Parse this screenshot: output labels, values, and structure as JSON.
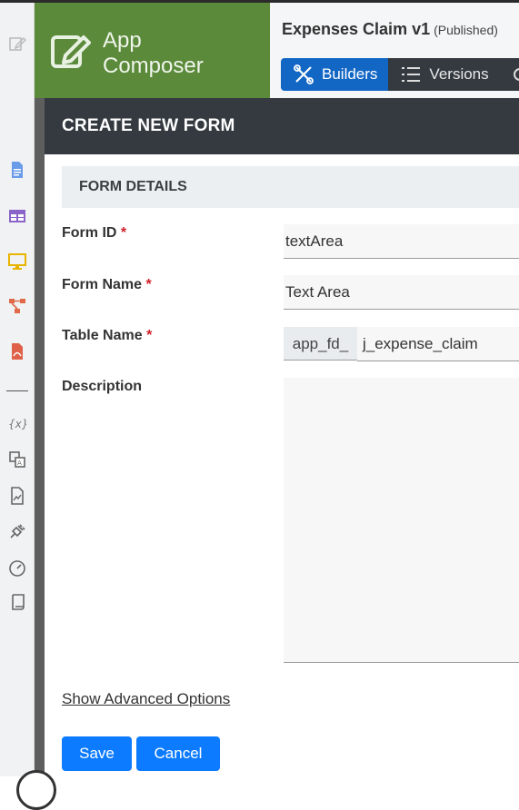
{
  "brand": {
    "line1": "App",
    "line2": "Composer",
    "icon": "edit-icon",
    "color": "#5b8a3a"
  },
  "app": {
    "title": "Expenses Claim v1",
    "status": "(Published)",
    "tabs": [
      {
        "label": "Builders",
        "icon": "tools-icon",
        "active": true
      },
      {
        "label": "Versions",
        "icon": "list-icon",
        "active": false
      }
    ]
  },
  "sidebar": {
    "icons": [
      "edit-icon",
      "form-icon",
      "table-icon",
      "monitor-icon",
      "process-icon",
      "pdf-icon",
      "variable-icon",
      "translate-icon",
      "report-icon",
      "plugin-icon",
      "dashboard-icon",
      "scroll-icon"
    ]
  },
  "modal": {
    "title": "CREATE NEW FORM",
    "section_title": "FORM DETAILS",
    "fields": {
      "form_id": {
        "label": "Form ID",
        "required": "*",
        "value": "textArea"
      },
      "form_name": {
        "label": "Form Name",
        "required": "*",
        "value": "Text Area"
      },
      "table_name": {
        "label": "Table Name",
        "required": "*",
        "prefix": "app_fd_",
        "value": "j_expense_claim"
      },
      "description": {
        "label": "Description",
        "value": ""
      }
    },
    "advanced_link": "Show Advanced Options",
    "save_label": "Save",
    "cancel_label": "Cancel"
  },
  "colors": {
    "primary": "#0d7bff",
    "header_dark": "#343a40",
    "required": "#d0202a",
    "active_tab": "#1266c4"
  }
}
